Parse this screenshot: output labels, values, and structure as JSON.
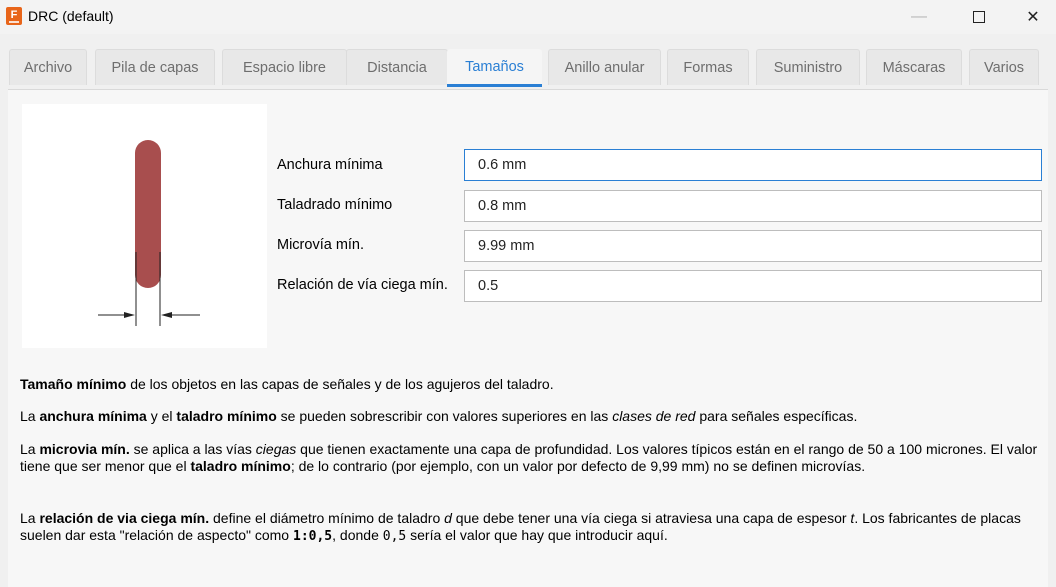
{
  "window": {
    "title": "DRC (default)",
    "icon_letter": "F",
    "minimize": "—",
    "close": "✕"
  },
  "tabs": [
    {
      "label": "Archivo",
      "active": false
    },
    {
      "label": "Pila de capas",
      "active": false
    },
    {
      "label": "Espacio libre",
      "active": false
    },
    {
      "label": "Distancia",
      "active": false
    },
    {
      "label": "Tamaños",
      "active": true
    },
    {
      "label": "Anillo anular",
      "active": false
    },
    {
      "label": "Formas",
      "active": false
    },
    {
      "label": "Suministro",
      "active": false
    },
    {
      "label": "Máscaras",
      "active": false
    },
    {
      "label": "Varios",
      "active": false
    }
  ],
  "form": {
    "min_width": {
      "label": "Anchura mínima",
      "value": "0.6 mm"
    },
    "min_drill": {
      "label": "Taladrado mínimo",
      "value": "0.8 mm"
    },
    "min_microvia": {
      "label": "Microvía mín.",
      "value": "9.99 mm"
    },
    "blind_via_ratio": {
      "label": "Relación de vía ciega mín.",
      "value": "0.5"
    }
  },
  "colors": {
    "trace": "#a84e4e",
    "accent": "#2a7fd4"
  },
  "description": {
    "p1": {
      "b1": "Tamaño mínimo",
      "t1": " de los objetos en las capas de señales y de los agujeros del taladro."
    },
    "p2": {
      "t1": "La ",
      "b1": "anchura mínima",
      "t2": " y el ",
      "b2": "taladro mínimo",
      "t3": " se pueden sobrescribir con valores superiores en las ",
      "i1": "clases de red",
      "t4": " para señales específicas."
    },
    "p3": {
      "t1": "La ",
      "b1": "microvia mín.",
      "t2": " se aplica a las vías ",
      "i1": "ciegas",
      "t3": " que tienen exactamente una capa de profundidad. Los valores típicos están en el rango de 50 a 100 micrones. El valor tiene que ser menor que el ",
      "b2": "taladro mínimo",
      "t4": "; de lo contrario (por ejemplo, con un valor por defecto de 9,99 mm) no se definen microvías."
    },
    "p4": {
      "t1": "La ",
      "b1": "relación de via ciega mín.",
      "t2": " define el diámetro mínimo de taladro ",
      "i1": "d",
      "t3": " que debe tener una vía ciega si atraviesa una capa de espesor ",
      "i2": "t",
      "t4": ". Los fabricantes de placas suelen dar esta \"relación de aspecto\" como ",
      "m1": "1:0,5",
      "t5": ", donde ",
      "m2": "0,5",
      "t6": " sería el valor que hay que introducir aquí."
    }
  }
}
